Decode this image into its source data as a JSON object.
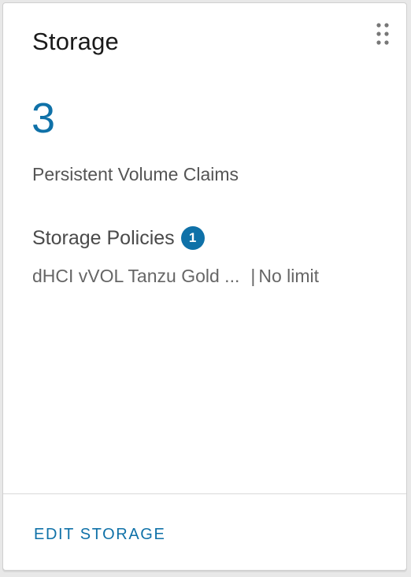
{
  "card": {
    "title": "Storage",
    "drag_icon": "drag-handle-icon",
    "count": "3",
    "count_label": "Persistent Volume Claims",
    "policies": {
      "title": "Storage Policies",
      "badge_count": "1",
      "items": [
        {
          "name": "dHCI vVOL Tanzu Gold ...",
          "separator": "|",
          "limit": "No limit"
        }
      ]
    },
    "footer": {
      "edit_label": "EDIT STORAGE"
    }
  },
  "colors": {
    "accent": "#0f71a8",
    "title_text": "#1a1a1a",
    "muted_text": "#666666",
    "background": "#e8e8e8",
    "card": "#ffffff"
  }
}
